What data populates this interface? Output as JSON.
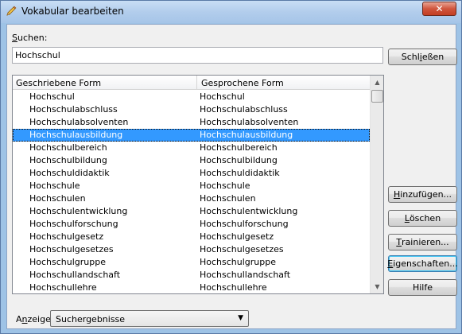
{
  "window": {
    "title": "Vokabular bearbeiten",
    "close_glyph": "✕"
  },
  "search": {
    "label_first": "S",
    "label_rest": "uchen:",
    "value": "Hochschul"
  },
  "buttons": {
    "close": {
      "first": "Schl",
      "u": "i",
      "rest": "eßen"
    },
    "add": {
      "u": "H",
      "rest": "inzufügen..."
    },
    "delete": {
      "u": "L",
      "rest": "öschen"
    },
    "train": {
      "u": "T",
      "rest": "rainieren..."
    },
    "properties": {
      "u": "E",
      "rest": "igenschaften..."
    },
    "help": {
      "label": "Hilfe"
    }
  },
  "list": {
    "columns": [
      "Geschriebene Form",
      "Gesprochene Form"
    ],
    "selected_index": 3,
    "rows": [
      [
        "Hochschul",
        "Hochschul"
      ],
      [
        "Hochschulabschluss",
        "Hochschulabschluss"
      ],
      [
        "Hochschulabsolventen",
        "Hochschulabsolventen"
      ],
      [
        "Hochschulausbildung",
        "Hochschulausbildung"
      ],
      [
        "Hochschulbereich",
        "Hochschulbereich"
      ],
      [
        "Hochschulbildung",
        "Hochschulbildung"
      ],
      [
        "Hochschuldidaktik",
        "Hochschuldidaktik"
      ],
      [
        "Hochschule",
        "Hochschule"
      ],
      [
        "Hochschulen",
        "Hochschulen"
      ],
      [
        "Hochschulentwicklung",
        "Hochschulentwicklung"
      ],
      [
        "Hochschulforschung",
        "Hochschulforschung"
      ],
      [
        "Hochschulgesetz",
        "Hochschulgesetz"
      ],
      [
        "Hochschulgesetzes",
        "Hochschulgesetzes"
      ],
      [
        "Hochschulgruppe",
        "Hochschulgruppe"
      ],
      [
        "Hochschullandschaft",
        "Hochschullandschaft"
      ],
      [
        "Hochschullehre",
        "Hochschullehre"
      ]
    ]
  },
  "display": {
    "label_first": "A",
    "label_u": "n",
    "label_rest": "zeige:",
    "selected": "Suchergebnisse"
  },
  "colors": {
    "selection": "#3399ff",
    "titlebar": "#b2cdec",
    "close": "#c33e23"
  }
}
